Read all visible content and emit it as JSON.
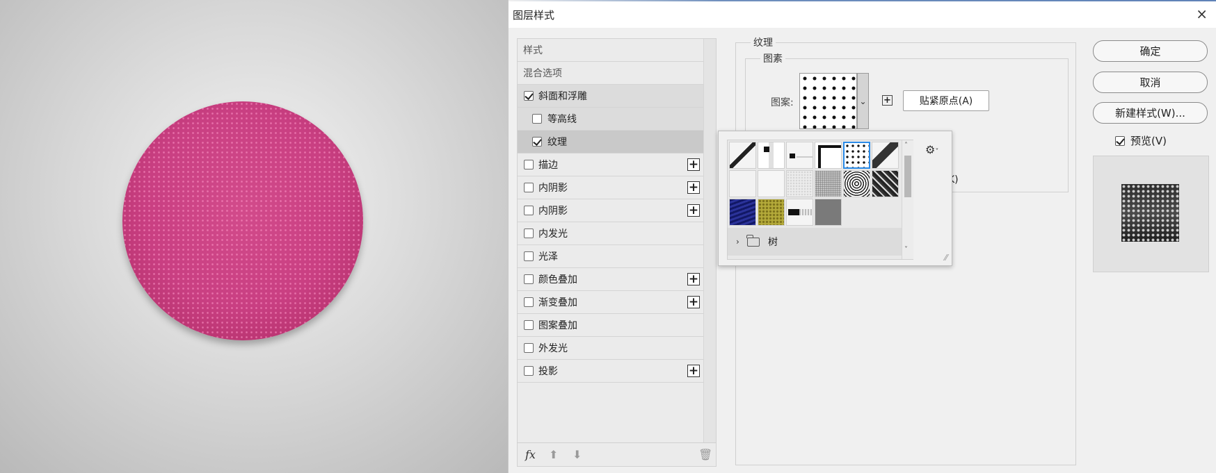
{
  "dialog": {
    "title": "图层样式",
    "close_glyph": "×"
  },
  "styles": {
    "header": "样式",
    "blend": "混合选项",
    "items": [
      {
        "label": "斜面和浮雕",
        "checked": true
      },
      {
        "label": "等高线",
        "checked": false
      },
      {
        "label": "纹理",
        "checked": true
      },
      {
        "label": "描边",
        "checked": false
      },
      {
        "label": "内阴影",
        "checked": false
      },
      {
        "label": "内阴影",
        "checked": false
      },
      {
        "label": "内发光",
        "checked": false
      },
      {
        "label": "光泽",
        "checked": false
      },
      {
        "label": "颜色叠加",
        "checked": false
      },
      {
        "label": "渐变叠加",
        "checked": false
      },
      {
        "label": "图案叠加",
        "checked": false
      },
      {
        "label": "外发光",
        "checked": false
      },
      {
        "label": "投影",
        "checked": false
      }
    ],
    "plus_glyph": "+",
    "bottom": {
      "fx": "fx",
      "up": "⬆",
      "down": "⬇",
      "trash": "🗑"
    }
  },
  "texture": {
    "section_title": "纹理",
    "group_title": "图素",
    "pattern_label": "图案:",
    "snap_button": "贴紧原点(A)",
    "partial_text": "K)",
    "picker": {
      "folder_name": "树",
      "chevron": "›",
      "gear": "⚙",
      "gear_caret": "˅"
    }
  },
  "buttons": {
    "ok": "确定",
    "cancel": "取消",
    "new_style": "新建样式(W)...",
    "preview": "预览(V)"
  },
  "colors": {
    "disc": "#c93f82",
    "selection_blue": "#2a8be8"
  }
}
